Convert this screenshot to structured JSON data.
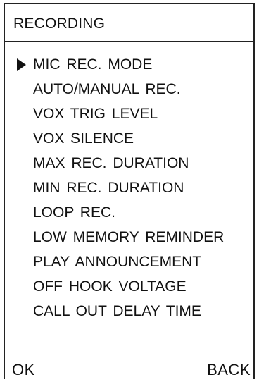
{
  "title": "RECORDING",
  "menu": {
    "selected_index": 0,
    "items": [
      {
        "label": "MIC REC. MODE"
      },
      {
        "label": "AUTO/MANUAL REC."
      },
      {
        "label": "VOX TRIG LEVEL"
      },
      {
        "label": "VOX SILENCE"
      },
      {
        "label": "MAX REC. DURATION"
      },
      {
        "label": "MIN REC. DURATION"
      },
      {
        "label": "LOOP REC."
      },
      {
        "label": "LOW MEMORY REMINDER"
      },
      {
        "label": "PLAY ANNOUNCEMENT"
      },
      {
        "label": "OFF HOOK VOLTAGE"
      },
      {
        "label": "CALL OUT DELAY TIME"
      }
    ]
  },
  "softkeys": {
    "left": "OK",
    "right": "BACK"
  },
  "icons": {
    "cursor": "triangle-right-icon"
  }
}
